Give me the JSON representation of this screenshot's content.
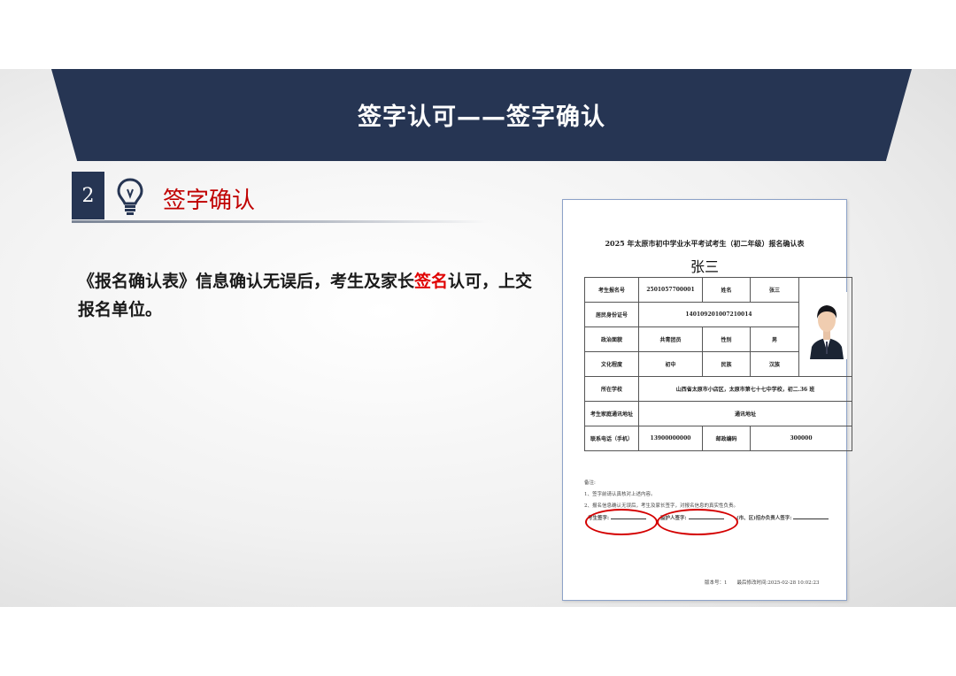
{
  "header": {
    "title": "签字认可——签字确认"
  },
  "section": {
    "number": "2",
    "title": "签字确认",
    "icon": "lightbulb-icon"
  },
  "body_text": {
    "part1": "《报名确认表》信息确认无误后，考生及家长",
    "highlight": "签名",
    "part2": "认可，上交报名单位。"
  },
  "colors": {
    "banner": "#263553",
    "accent_red": "#c00000",
    "highlight_red": "#e00000",
    "oval_red": "#d40000"
  },
  "document": {
    "title": "2025 年太原市初中学业水平考试考生（初二年级）报名确认表",
    "name": "张三",
    "rows": [
      {
        "l1": "考生报名号",
        "v1": "2501057700001",
        "l2": "姓名",
        "v2": "张三"
      },
      {
        "l1": "居民身份证号",
        "v1": "140109201007210014"
      },
      {
        "l1": "政治面貌",
        "v1": "共青团员",
        "l2": "性别",
        "v2": "男"
      },
      {
        "l1": "文化程度",
        "v1": "初中",
        "l2": "民族",
        "v2": "汉族"
      },
      {
        "l1": "所在学校",
        "v1": "山西省太原市小店区，太原市第七十七中学校，初二.36 班"
      },
      {
        "l1": "考生家庭通讯地址",
        "v1": "通讯地址"
      },
      {
        "l1": "联系电话（手机）",
        "v1": "13900000000",
        "l2": "邮政编码",
        "v2": "300000"
      }
    ],
    "notes_title": "备注:",
    "note1": "1、签字前请认真核对上述内容。",
    "note2": "2、报名信息确认无误后，考生及家长签字，对报名信息的真实性负责。",
    "sign_student": "考生签字:",
    "sign_guardian": "监护人签字:",
    "sign_office": "(市、区)招办负责人签字:",
    "version": "版本号：1　　最后修改时间:2025-02-28 10:02:23"
  }
}
